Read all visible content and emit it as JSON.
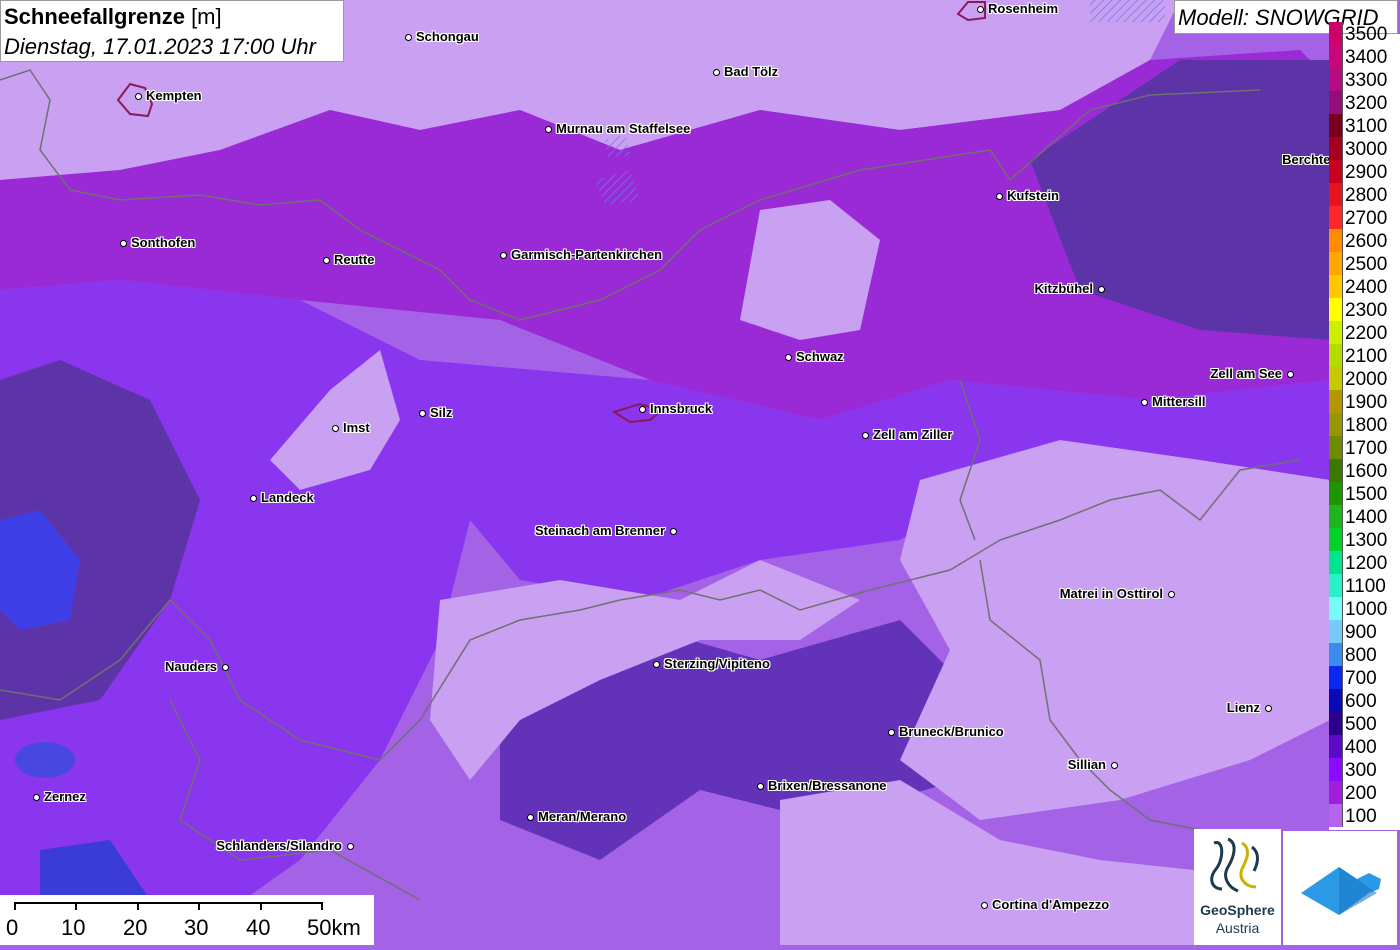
{
  "title": {
    "bold": "Schneefallgrenze",
    "unit": " [m]",
    "date": "Dienstag, 17.01.2023 17:00 Uhr"
  },
  "model": "Modell: SNOWGRID",
  "legend": [
    {
      "label": "3500",
      "color": "#d0006a"
    },
    {
      "label": "3400",
      "color": "#c8087a"
    },
    {
      "label": "3300",
      "color": "#b40c82"
    },
    {
      "label": "3200",
      "color": "#960c7a"
    },
    {
      "label": "3100",
      "color": "#78001e"
    },
    {
      "label": "3000",
      "color": "#a4001e"
    },
    {
      "label": "2900",
      "color": "#c8001e"
    },
    {
      "label": "2800",
      "color": "#e6141e"
    },
    {
      "label": "2700",
      "color": "#ff2828"
    },
    {
      "label": "2600",
      "color": "#ff8c00"
    },
    {
      "label": "2500",
      "color": "#ffa600"
    },
    {
      "label": "2400",
      "color": "#ffc800"
    },
    {
      "label": "2300",
      "color": "#ffff00"
    },
    {
      "label": "2200",
      "color": "#c8f000"
    },
    {
      "label": "2100",
      "color": "#b4dc00"
    },
    {
      "label": "2000",
      "color": "#c8c800"
    },
    {
      "label": "1900",
      "color": "#b49600"
    },
    {
      "label": "1800",
      "color": "#969600"
    },
    {
      "label": "1700",
      "color": "#6e8c00"
    },
    {
      "label": "1600",
      "color": "#3c7800"
    },
    {
      "label": "1500",
      "color": "#1e9600"
    },
    {
      "label": "1400",
      "color": "#1eb41e"
    },
    {
      "label": "1300",
      "color": "#00d228"
    },
    {
      "label": "1200",
      "color": "#00e68c"
    },
    {
      "label": "1100",
      "color": "#28f0c8"
    },
    {
      "label": "1000",
      "color": "#78fafa"
    },
    {
      "label": "900",
      "color": "#78c8fa"
    },
    {
      "label": "800",
      "color": "#3c8cf0"
    },
    {
      "label": "700",
      "color": "#0a28f0"
    },
    {
      "label": "600",
      "color": "#0a0ab4"
    },
    {
      "label": "500",
      "color": "#28008c"
    },
    {
      "label": "400",
      "color": "#5a0ac8"
    },
    {
      "label": "300",
      "color": "#8c0aff"
    },
    {
      "label": "200",
      "color": "#a01edc"
    },
    {
      "label": "100",
      "color": "#b464f0"
    }
  ],
  "cities": [
    {
      "name": "Schongau"
    },
    {
      "name": "Rosenheim"
    },
    {
      "name": "Kempten"
    },
    {
      "name": "Bad Tölz"
    },
    {
      "name": "Murnau am Staffelsee"
    },
    {
      "name": "Berchtesgaden"
    },
    {
      "name": "Kufstein"
    },
    {
      "name": "Sonthofen"
    },
    {
      "name": "Reutte"
    },
    {
      "name": "Garmisch-Partenkirchen"
    },
    {
      "name": "Kitzbühel"
    },
    {
      "name": "Schwaz"
    },
    {
      "name": "Zell am See"
    },
    {
      "name": "Mittersill"
    },
    {
      "name": "Imst"
    },
    {
      "name": "Silz"
    },
    {
      "name": "Innsbruck"
    },
    {
      "name": "Zell am Ziller"
    },
    {
      "name": "Landeck"
    },
    {
      "name": "Steinach am Brenner"
    },
    {
      "name": "Matrei in Osttirol"
    },
    {
      "name": "Nauders"
    },
    {
      "name": "Sterzing/Vipiteno"
    },
    {
      "name": "Lienz"
    },
    {
      "name": "Bruneck/Brunico"
    },
    {
      "name": "Sillian"
    },
    {
      "name": "Brixen/Bressanone"
    },
    {
      "name": "Zernez"
    },
    {
      "name": "Meran/Merano"
    },
    {
      "name": "Schlanders/Silandro"
    },
    {
      "name": "Cortina d'Ampezzo"
    }
  ],
  "scale": {
    "labels": [
      "0",
      "10",
      "20",
      "30",
      "40",
      "50km"
    ]
  },
  "logo": {
    "line1": "GeoSphere",
    "line2": "Austria"
  },
  "colors": {
    "base": "#a463e6",
    "light": "#c9a0f2",
    "dark": "#5d34a8",
    "mid": "#8a35ee",
    "magenta": "#9a2ad6",
    "blue": "#3f3fe8"
  }
}
